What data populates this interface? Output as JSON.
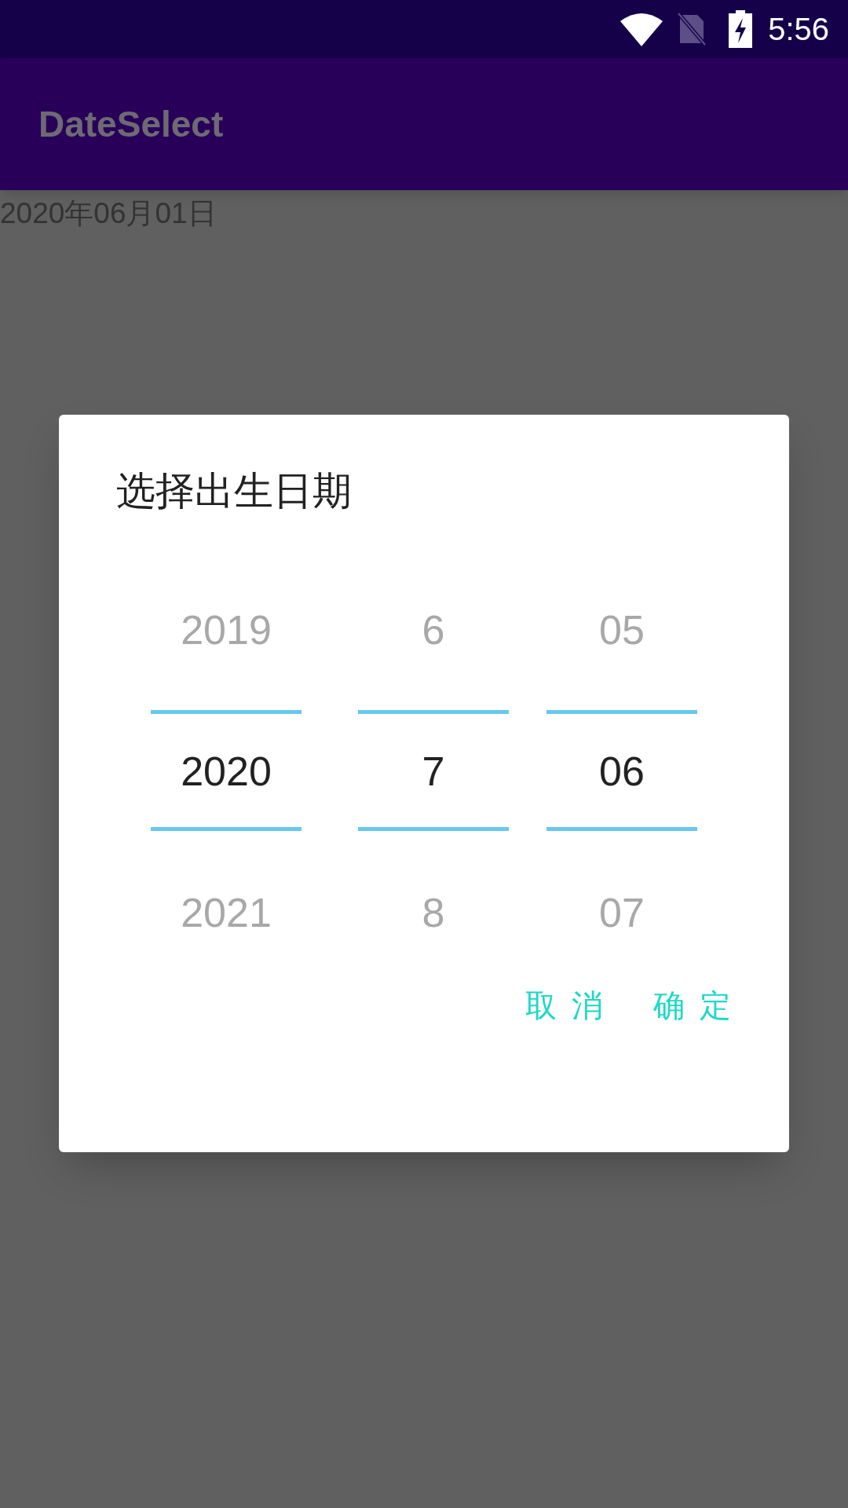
{
  "status_bar": {
    "time": "5:56"
  },
  "app_bar": {
    "title": "DateSelect"
  },
  "content": {
    "date_text": "2020年06月01日"
  },
  "dialog": {
    "title": "选择出生日期",
    "columns": [
      {
        "items": [
          {
            "label": "2019",
            "selected": false
          },
          {
            "label": "2020",
            "selected": true
          },
          {
            "label": "2021",
            "selected": false
          }
        ]
      },
      {
        "items": [
          {
            "label": "6",
            "selected": false
          },
          {
            "label": "7",
            "selected": true
          },
          {
            "label": "8",
            "selected": false
          }
        ]
      },
      {
        "items": [
          {
            "label": "05",
            "selected": false
          },
          {
            "label": "06",
            "selected": true
          },
          {
            "label": "07",
            "selected": false
          }
        ]
      }
    ],
    "buttons": [
      "取 消",
      "确 定"
    ]
  }
}
